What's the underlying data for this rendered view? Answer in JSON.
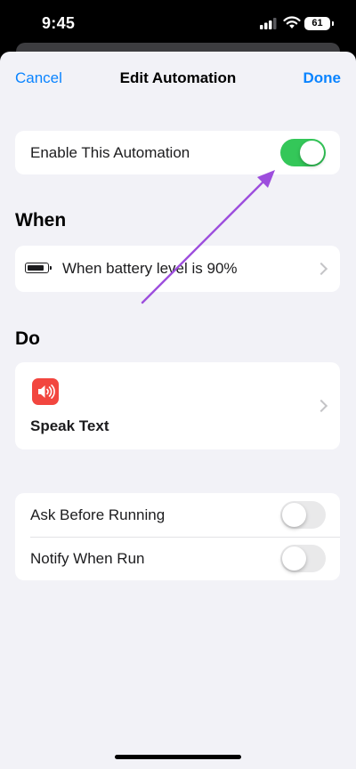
{
  "status_bar": {
    "time": "9:45",
    "battery_level": "61",
    "icons": [
      "cellular-signal-icon",
      "wifi-icon",
      "battery-icon"
    ]
  },
  "nav": {
    "cancel": "Cancel",
    "title": "Edit Automation",
    "done": "Done"
  },
  "enable": {
    "label": "Enable This Automation",
    "on": true
  },
  "when": {
    "heading": "When",
    "trigger": "When battery level is 90%",
    "battery_fill_fraction": 0.9,
    "icon": "battery-icon"
  },
  "do": {
    "heading": "Do",
    "action": "Speak Text",
    "icon": "speaker-icon",
    "icon_color": "#f2463f"
  },
  "options": [
    {
      "label": "Ask Before Running",
      "on": false
    },
    {
      "label": "Notify When Run",
      "on": false
    }
  ],
  "colors": {
    "accent": "#0a84ff",
    "toggle_on": "#34c759",
    "annotation_arrow": "#9d4edd"
  }
}
